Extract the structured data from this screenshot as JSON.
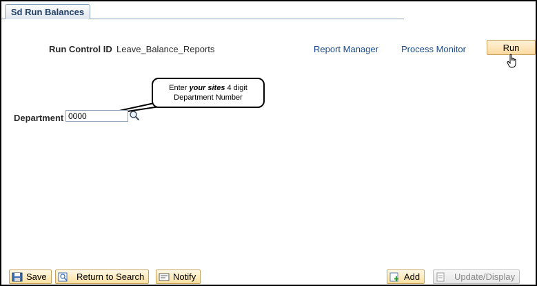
{
  "tab": {
    "label": "Sd Run Balances"
  },
  "run_control": {
    "label": "Run Control ID",
    "value": "Leave_Balance_Reports"
  },
  "links": {
    "report_manager": "Report Manager",
    "process_monitor": "Process Monitor"
  },
  "run_button": {
    "label": "Run"
  },
  "callout": {
    "line1_prefix": "Enter ",
    "line1_emph": "your sites",
    "line1_suffix": " 4 digit",
    "line2": "Department Number"
  },
  "department": {
    "label": "Department",
    "value": "0000"
  },
  "toolbar": {
    "save": "Save",
    "return_to_search": "Return to Search",
    "notify": "Notify",
    "add": "Add",
    "update_display": "Update/Display"
  },
  "colors": {
    "link": "#1a4b8c",
    "button_fill": "#fbd9a0",
    "tab_text": "#1f3e66"
  }
}
